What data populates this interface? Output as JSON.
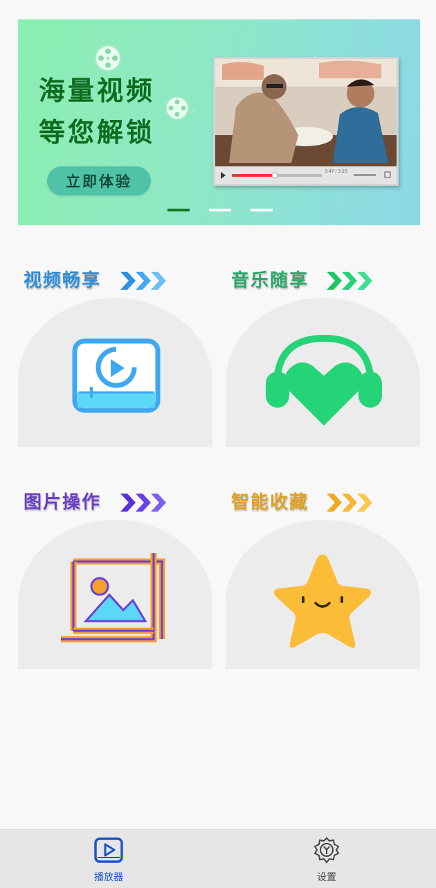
{
  "banner": {
    "line1": "海量视频",
    "line2": "等您解锁",
    "cta": "立即体验",
    "time_readout": "3:47 / 3:25",
    "slide_count": 3,
    "active_slide": 1
  },
  "features": [
    {
      "title": "视频畅享",
      "color": "#2f8fd8",
      "chevron_color": "#3a9ff0",
      "icon": "video-play-icon"
    },
    {
      "title": "音乐随享",
      "color": "#2aa86a",
      "chevron_color": "#25d27a",
      "icon": "heart-headphones-icon"
    },
    {
      "title": "图片操作",
      "color": "#6a3fc8",
      "chevron_color": "#6a3fe0",
      "icon": "image-crop-icon"
    },
    {
      "title": "智能收藏",
      "color": "#e0a020",
      "chevron_color": "#f5b830",
      "icon": "smiling-star-icon"
    }
  ],
  "bottom_nav": {
    "items": [
      {
        "label": "播放器",
        "icon": "player-icon",
        "active": true,
        "color": "#1a56c8"
      },
      {
        "label": "设置",
        "icon": "settings-gear-icon",
        "active": false,
        "color": "#444444"
      }
    ]
  }
}
